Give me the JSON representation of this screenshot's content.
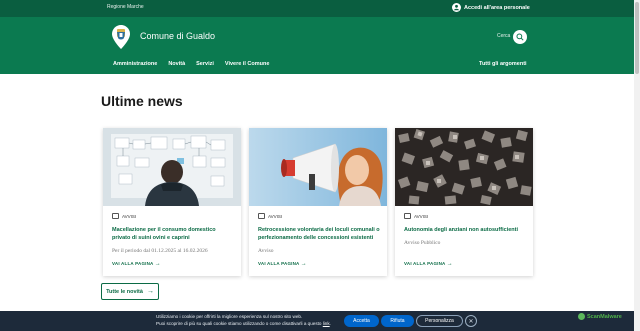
{
  "topbar": {
    "region": "Regione Marche",
    "login": "Accedi all'area personale"
  },
  "header": {
    "site_name": "Comune di Gualdo",
    "search_label": "Cerca",
    "nav": [
      "Amministrazione",
      "Novità",
      "Servizi",
      "Vivere il Comune"
    ],
    "all_topics": "Tutti gli argomenti"
  },
  "section": {
    "title": "Ultime news",
    "all_news": "Tutte le novità"
  },
  "cards": [
    {
      "category": "AVVISI",
      "title": "Macellazione per il consumo domestico privato di suini ovini e caprini",
      "meta": "Per il periodo dal 01.12.2025 al 16.02.2026",
      "more": "VAI ALLA PAGINA"
    },
    {
      "category": "AVVISI",
      "title": "Retrocessione volontaria dei loculi comunali o perfezionamento delle concessioni esistenti",
      "meta": "Avviso",
      "more": "VAI ALLA PAGINA"
    },
    {
      "category": "AVVISI",
      "title": "Autonomia degli anziani non autosufficienti",
      "meta": "Avviso Pubblico",
      "more": "VAI ALLA PAGINA"
    }
  ],
  "cookie": {
    "line1": "Utilizziamo i cookie per offrirti la migliore esperienza sul nostro sito web.",
    "line2": "Puoi scoprire di più su quali cookie stiamo utilizzando o come disattivarli a questo",
    "link": "link",
    "accept": "Accetta",
    "reject": "Rifiuta",
    "customize": "Personalizza"
  },
  "watermark": "ScanMalware",
  "colors": {
    "header": "#0b7a50",
    "topbar": "#0a5e40",
    "accent": "#0b6b45",
    "cookie_bg": "#1d2a3a",
    "cookie_btn": "#0066cc"
  },
  "icons": [
    "user-icon",
    "coat-of-arms-logo",
    "search-icon",
    "calendar-icon",
    "arrow-right-icon",
    "close-icon"
  ]
}
